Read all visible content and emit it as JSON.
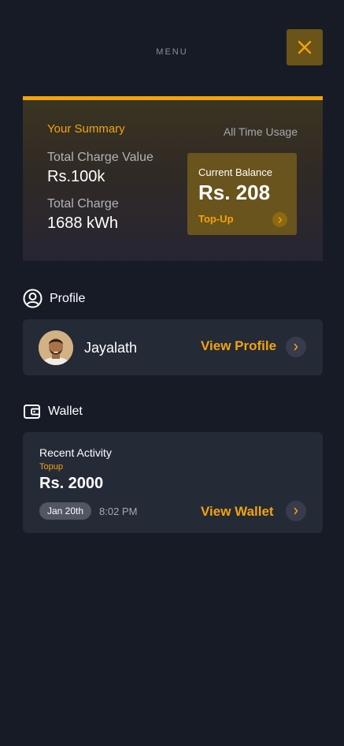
{
  "header": {
    "title": "MENU"
  },
  "summary": {
    "title": "Your Summary",
    "period": "All Time Usage",
    "total_charge_value_label": "Total Charge Value",
    "total_charge_value": "Rs.100k",
    "total_charge_label": "Total Charge",
    "total_charge": "1688 kWh",
    "balance": {
      "label": "Current Balance",
      "value": "Rs. 208",
      "topup_label": "Top-Up"
    }
  },
  "profile": {
    "section_label": "Profile",
    "user_name": "Jayalath",
    "view_label": "View Profile"
  },
  "wallet": {
    "section_label": "Wallet",
    "activity_title": "Recent Activity",
    "activity_type": "Topup",
    "amount": "Rs. 2000",
    "date": "Jan 20th",
    "time": "8:02 PM",
    "view_label": "View Wallet"
  },
  "colors": {
    "accent": "#f3a30b",
    "background": "#171b26",
    "card": "#252a37"
  },
  "icons": {
    "close": "close-icon",
    "profile": "user-circle-icon",
    "wallet": "wallet-icon",
    "arrow": "chevron-right-icon"
  }
}
